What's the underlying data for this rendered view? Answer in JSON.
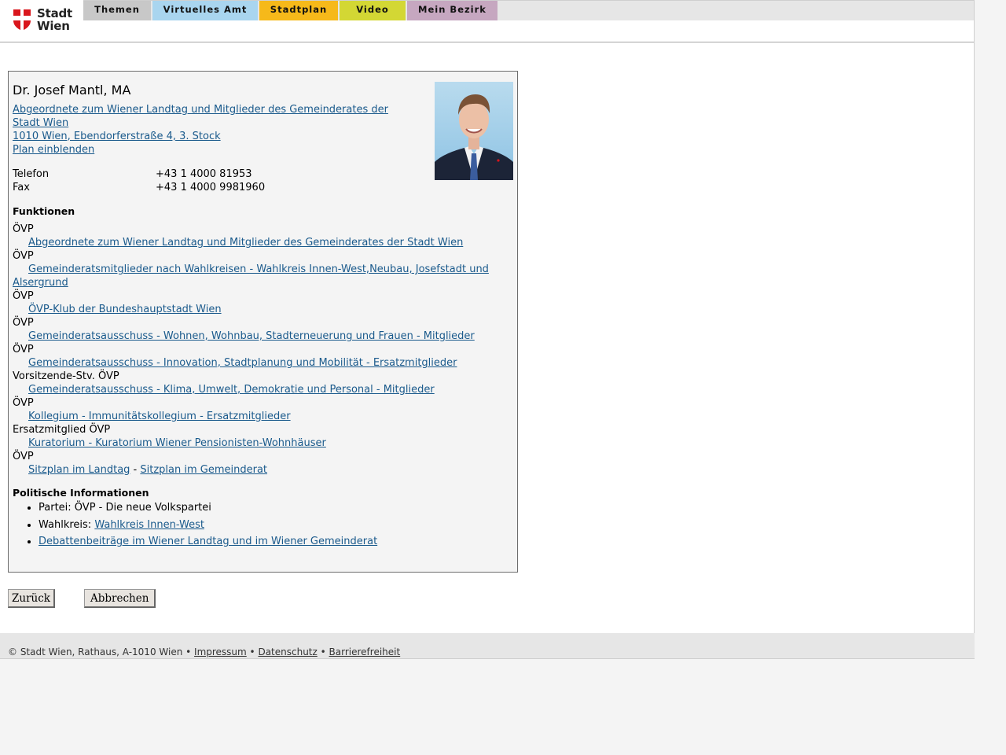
{
  "brand": {
    "line1": "Stadt",
    "line2": "Wien",
    "colors": {
      "red": "#d9161c"
    }
  },
  "nav": {
    "tabs": [
      {
        "label": "Themen",
        "color": "#c8c8c8"
      },
      {
        "label": "Virtuelles Amt",
        "color": "#a9d5ef"
      },
      {
        "label": "Stadtplan",
        "color": "#f6b91a"
      },
      {
        "label": "Video",
        "color": "#d3d734"
      },
      {
        "label": "Mein Bezirk",
        "color": "#c6a7c0"
      }
    ]
  },
  "person": {
    "name": "Dr. Josef Mantl, MA",
    "role_link_line1": "Abgeordnete zum Wiener Landtag und Mitglieder des Gemeinderates der",
    "role_link_line2": "Stadt Wien ",
    "address": "1010 Wien, Ebendorferstraße 4, 3. Stock",
    "map_link": "Plan einblenden",
    "phone_label": "Telefon",
    "phone": "+43 1 4000 81953",
    "fax_label": "Fax",
    "fax": "+43 1 4000 9981960"
  },
  "functions": {
    "heading": "Funktionen",
    "items": [
      {
        "party": "ÖVP",
        "link": "Abgeordnete zum Wiener Landtag und Mitglieder des Gemeinderates der Stadt Wien"
      },
      {
        "party": "ÖVP",
        "link": "Gemeinderatsmitglieder nach Wahlkreisen - Wahlkreis Innen-West,Neubau, Josefstadt und",
        "link_cont": "Alsergrund"
      },
      {
        "party": "ÖVP",
        "link": "ÖVP-Klub der Bundeshauptstadt Wien"
      },
      {
        "party": "ÖVP",
        "link": "Gemeinderatsausschuss - Wohnen, Wohnbau, Stadterneuerung und Frauen - Mitglieder"
      },
      {
        "party": "ÖVP",
        "link": "Gemeinderatsausschuss - Innovation, Stadtplanung und Mobilität - Ersatzmitglieder"
      },
      {
        "party": "Vorsitzende-Stv. ÖVP",
        "link": "Gemeinderatsausschuss - Klima, Umwelt, Demokratie und Personal - Mitglieder"
      },
      {
        "party": "ÖVP",
        "link": "Kollegium - Immunitätskollegium - Ersatzmitglieder"
      },
      {
        "party": "Ersatzmitglied ÖVP",
        "link": "Kuratorium - Kuratorium Wiener Pensionisten-Wohnhäuser"
      },
      {
        "party": "ÖVP",
        "link": "Sitzplan im Landtag",
        "separator": " - ",
        "link2": "Sitzplan im Gemeinderat"
      }
    ]
  },
  "political": {
    "heading": "Politische Informationen",
    "party_label": "Partei: ",
    "party_value": "ÖVP - Die neue Volkspartei",
    "district_label": "Wahlkreis: ",
    "district_link": "Wahlkreis Innen-West",
    "debates_link": "Debattenbeiträge im Wiener Landtag und im Wiener Gemeinderat"
  },
  "buttons": {
    "back": "Zurück",
    "cancel": "Abbrechen"
  },
  "footer": {
    "copyright": "© Stadt Wien, Rathaus, A-1010 Wien • ",
    "impressum": "Impressum",
    "sep1": " • ",
    "datenschutz": "Datenschutz",
    "sep2": " • ",
    "barrierefreiheit": "Barrierefreiheit"
  }
}
